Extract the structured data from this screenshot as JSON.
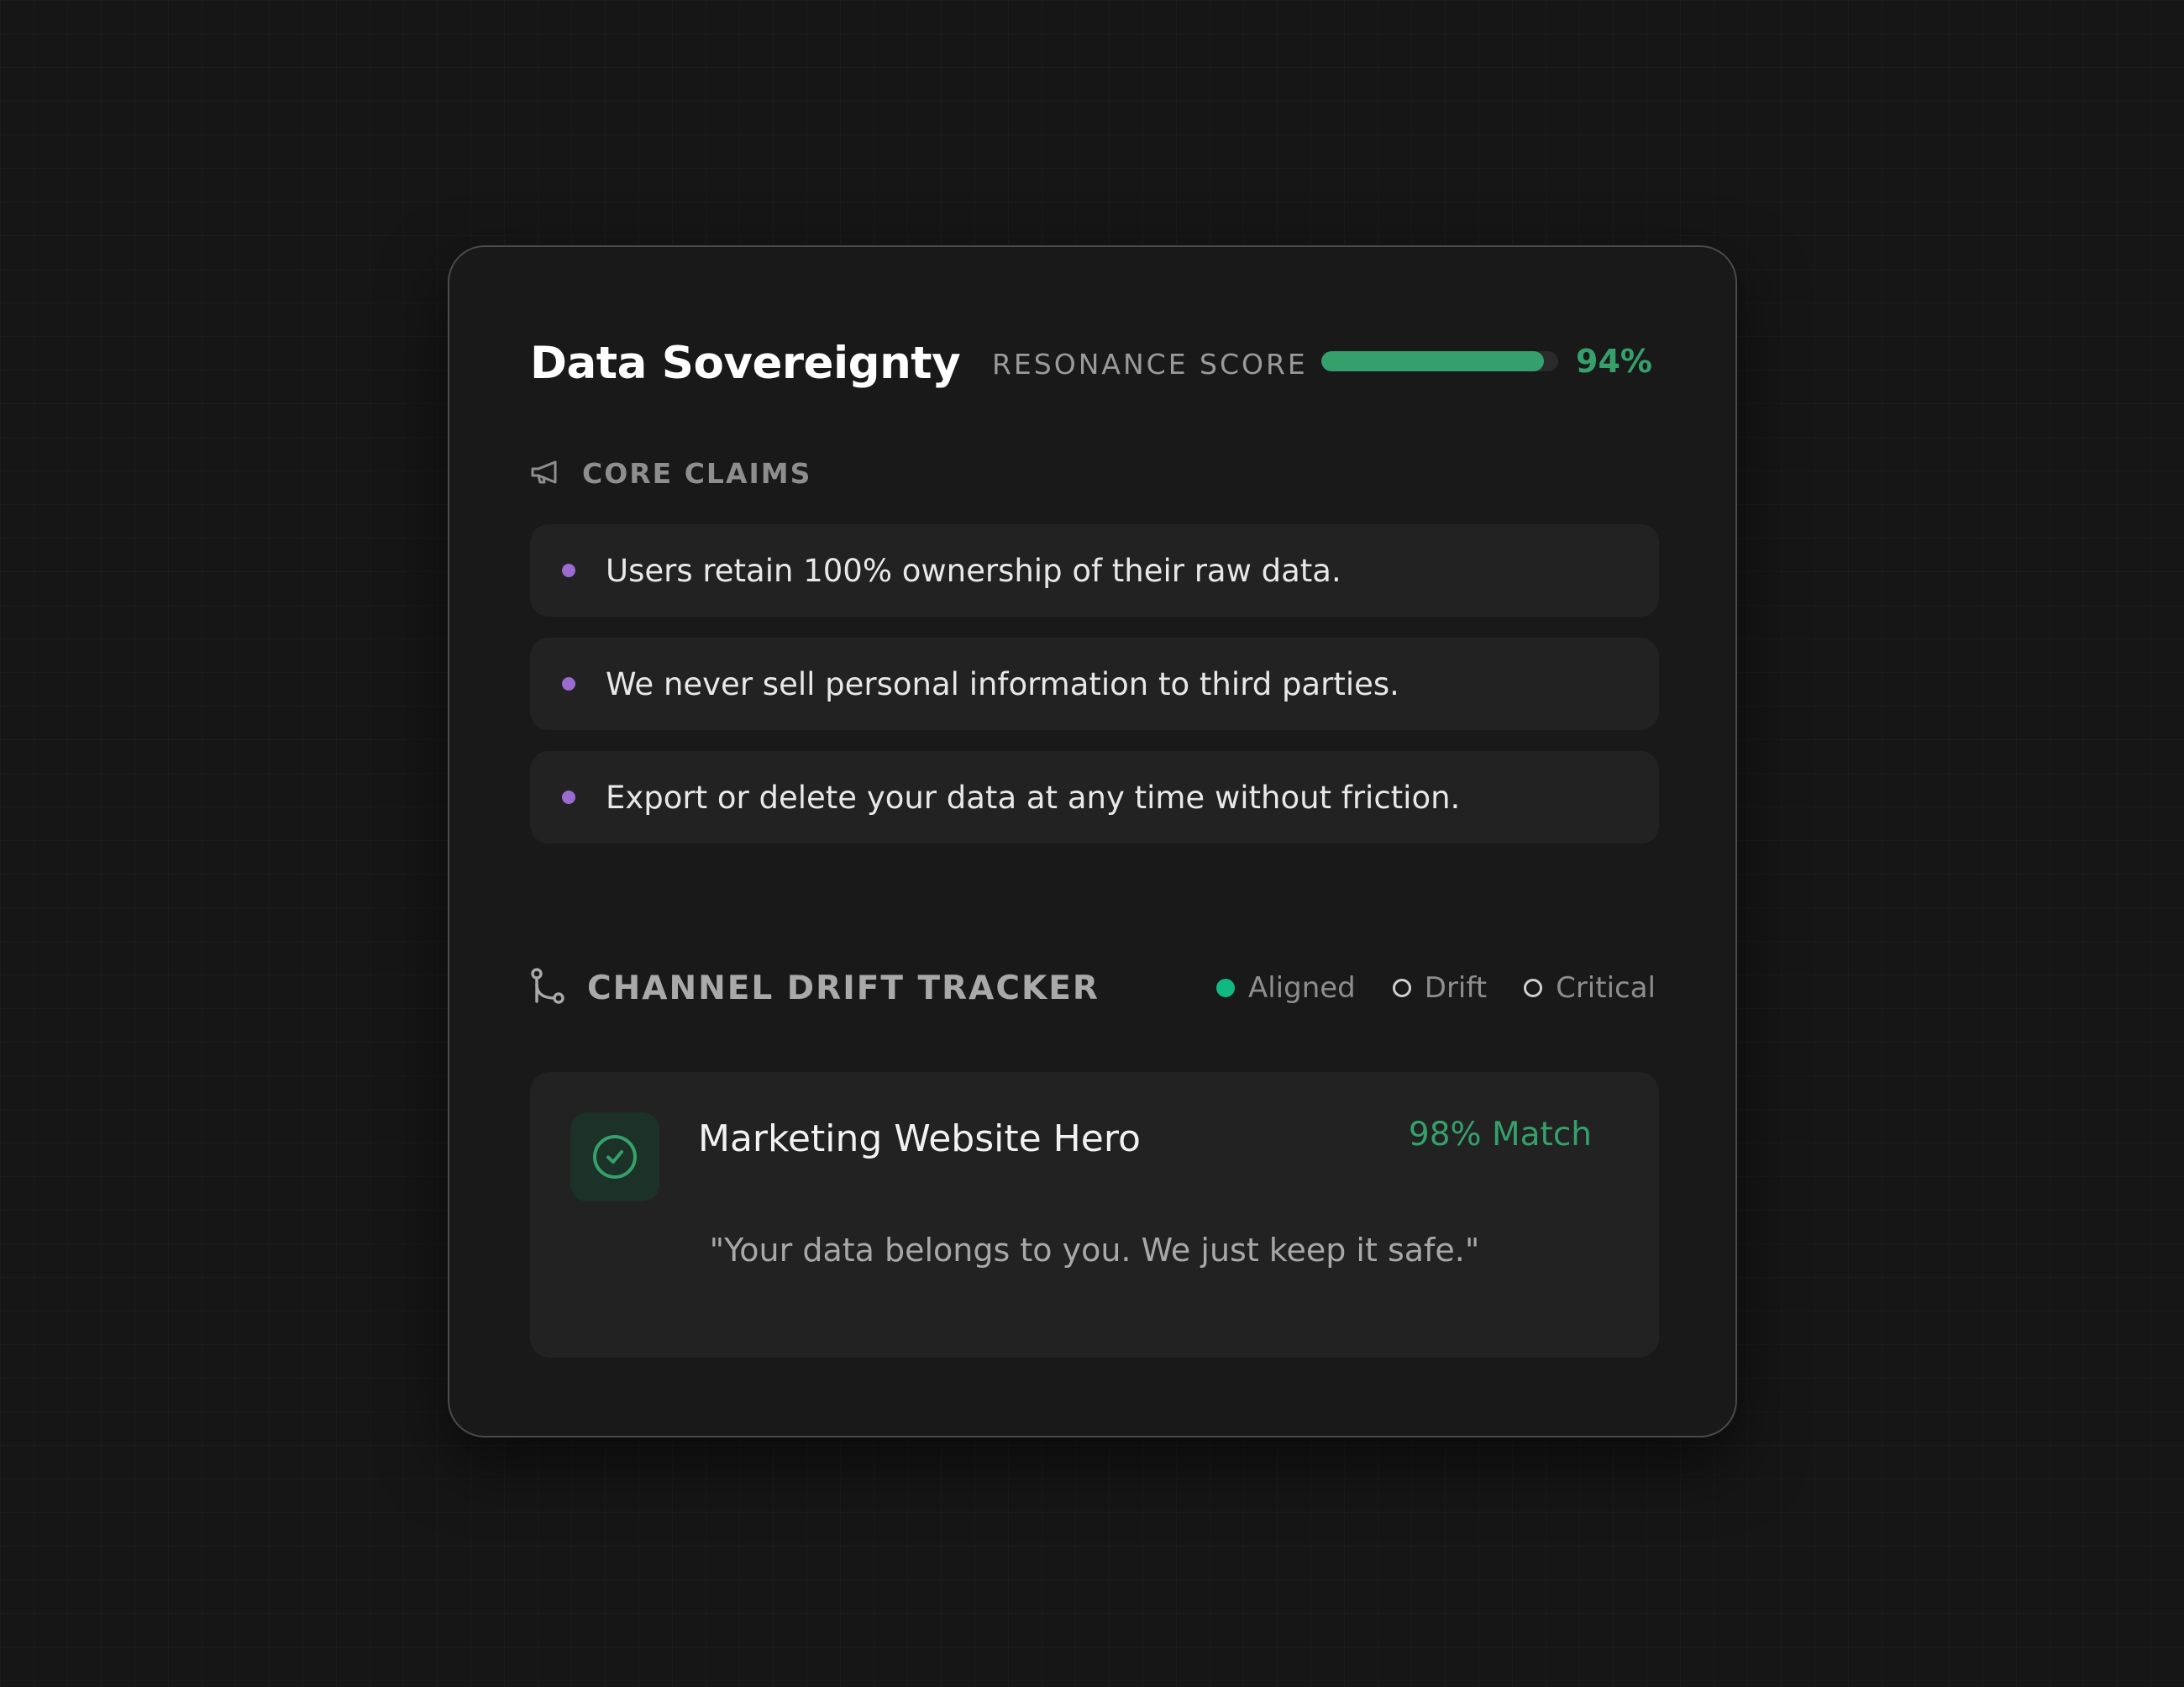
{
  "card": {
    "title": "Data Sovereignty",
    "resonance": {
      "label": "RESONANCE SCORE",
      "value": 94,
      "value_text": "94%",
      "color": "#35a06c"
    }
  },
  "core_claims": {
    "icon": "megaphone-icon",
    "label": "CORE CLAIMS",
    "bullet_color": "#9b6bd0",
    "items": [
      {
        "text": "Users retain 100% ownership of their raw data."
      },
      {
        "text": "We never sell personal information to third parties."
      },
      {
        "text": "Export or delete your data at any time without friction."
      }
    ]
  },
  "drift_tracker": {
    "icon": "git-branch-icon",
    "label": "CHANNEL DRIFT TRACKER",
    "legend": [
      {
        "label": "Aligned",
        "filled": true,
        "color": "#10b981"
      },
      {
        "label": "Drift",
        "filled": false
      },
      {
        "label": "Critical",
        "filled": false
      }
    ],
    "channel": {
      "icon": "check-circle-icon",
      "name": "Marketing Website Hero",
      "match": "98% Match",
      "quote": "\"Your data belongs to you. We just keep it safe.\""
    }
  }
}
